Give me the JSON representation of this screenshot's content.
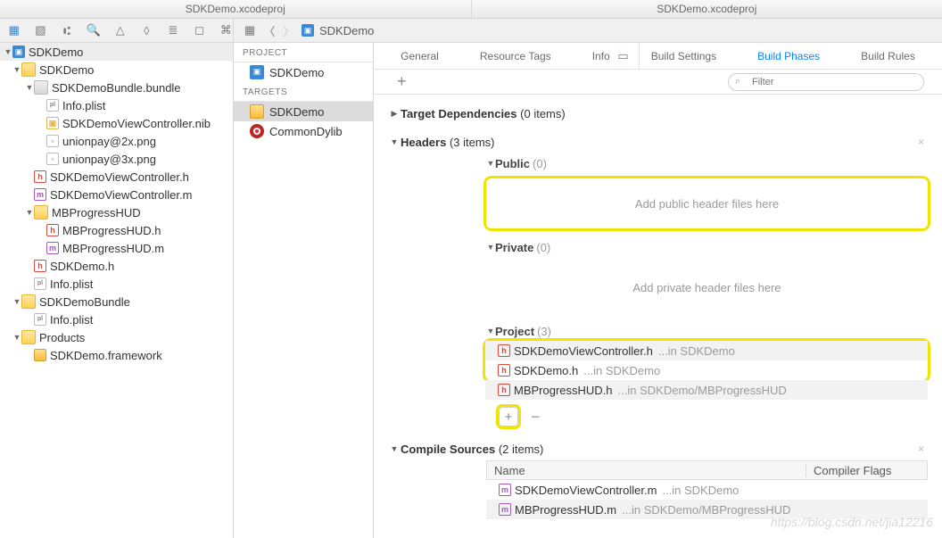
{
  "title_left": "SDKDemo.xcodeproj",
  "title_right": "SDKDemo.xcodeproj",
  "breadcrumb": "SDKDemo",
  "nav": {
    "root": "SDKDemo",
    "group1": "SDKDemo",
    "bundle": "SDKDemoBundle.bundle",
    "bundle_items": [
      "Info.plist",
      "SDKDemoViewController.nib",
      "unionpay@2x.png",
      "unionpay@3x.png"
    ],
    "sdkdemo_h": "SDKDemoViewController.h",
    "sdkdemo_m": "SDKDemoViewController.m",
    "mbp_group": "MBProgressHUD",
    "mbp_h": "MBProgressHUD.h",
    "mbp_m": "MBProgressHUD.m",
    "sdk_h": "SDKDemo.h",
    "info1": "Info.plist",
    "group2": "SDKDemoBundle",
    "info2": "Info.plist",
    "products": "Products",
    "framework": "SDKDemo.framework"
  },
  "center": {
    "project_label": "PROJECT",
    "project_name": "SDKDemo",
    "targets_label": "TARGETS",
    "target1": "SDKDemo",
    "target2": "CommonDylib"
  },
  "tabs": [
    "General",
    "Resource Tags",
    "Info",
    "Build Settings",
    "Build Phases",
    "Build Rules"
  ],
  "active_tab": "Build Phases",
  "filter_placeholder": "Filter",
  "phases": {
    "deps": {
      "title": "Target Dependencies",
      "count": "(0 items)"
    },
    "headers": {
      "title": "Headers",
      "count": "(3 items)",
      "public": {
        "label": "Public",
        "count": "(0)",
        "drop": "Add public header files here"
      },
      "private": {
        "label": "Private",
        "count": "(0)",
        "drop": "Add private header files here"
      },
      "project": {
        "label": "Project",
        "count": "(3)",
        "rows": [
          {
            "name": "SDKDemoViewController.h",
            "path": "...in SDKDemo"
          },
          {
            "name": "SDKDemo.h",
            "path": "...in SDKDemo"
          },
          {
            "name": "MBProgressHUD.h",
            "path": "...in SDKDemo/MBProgressHUD"
          }
        ]
      }
    },
    "sources": {
      "title": "Compile Sources",
      "count": "(2 items)",
      "cols": {
        "c1": "Name",
        "c2": "Compiler Flags"
      },
      "rows": [
        {
          "name": "SDKDemoViewController.m",
          "path": "...in SDKDemo"
        },
        {
          "name": "MBProgressHUD.m",
          "path": "...in SDKDemo/MBProgressHUD"
        }
      ]
    }
  },
  "watermark": "https://blog.csdn.net/jia12216"
}
